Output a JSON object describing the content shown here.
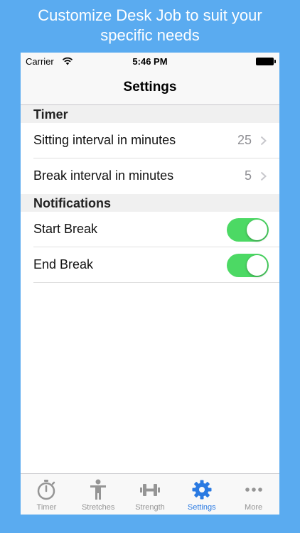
{
  "promo": {
    "line1": "Customize Desk Job to suit your",
    "line2": "specific needs"
  },
  "status_bar": {
    "carrier": "Carrier",
    "time": "5:46 PM"
  },
  "nav": {
    "title": "Settings"
  },
  "sections": {
    "timer": {
      "header": "Timer",
      "rows": [
        {
          "label": "Sitting interval in minutes",
          "value": "25"
        },
        {
          "label": "Break interval in minutes",
          "value": "5"
        }
      ]
    },
    "notifications": {
      "header": "Notifications",
      "rows": [
        {
          "label": "Start Break",
          "enabled": true
        },
        {
          "label": "End Break",
          "enabled": true
        }
      ]
    }
  },
  "tabs": [
    {
      "label": "Timer",
      "icon": "stopwatch-icon"
    },
    {
      "label": "Stretches",
      "icon": "person-icon"
    },
    {
      "label": "Strength",
      "icon": "dumbbell-icon"
    },
    {
      "label": "Settings",
      "icon": "gear-icon",
      "active": true
    },
    {
      "label": "More",
      "icon": "more-icon"
    }
  ],
  "colors": {
    "background": "#5aabf0",
    "toggle_on": "#4cd964",
    "tab_active": "#2a7ae2",
    "tab_inactive": "#959595"
  }
}
